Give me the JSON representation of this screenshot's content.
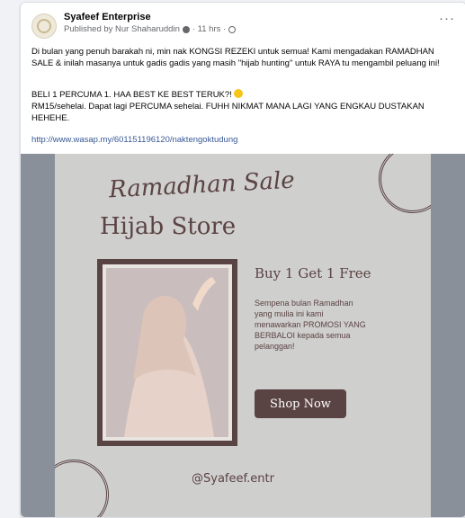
{
  "post": {
    "page_name": "Syafeef Enterprise",
    "published_by": "Published by Nur Shaharuddin",
    "time": "· 11 hrs ·",
    "more_label": "···",
    "paragraph1": "Di bulan yang penuh barakah ni, min nak KONGSI REZEKI untuk semua! Kami mengadakan RAMADHAN SALE & inilah masanya untuk gadis gadis yang masih \"hijab hunting\" untuk RAYA tu mengambil peluang ini!",
    "paragraph2_line1": "BELI 1 PERCUMA 1. HAA BEST KE BEST TERUK?!",
    "paragraph2_line2": "RM15/sehelai. Dapat lagi PERCUMA sehelai. FUHH NIKMAT MANA LAGI YANG ENGKAU DUSTAKAN HEHEHE.",
    "link": "http://www.wasap.my/601151196120/naktengoktudung"
  },
  "poster": {
    "script_title": "Ramadhan Sale",
    "title": "Hijab Store",
    "offer": "Buy 1 Get 1 Free",
    "promo_text": "Sempena bulan Ramadhan yang mulia ini kami menawarkan PROMOSI YANG BERBALOI kepada semua pelanggan!",
    "button": "Shop Now",
    "handle": "@Syafeef.entr"
  }
}
